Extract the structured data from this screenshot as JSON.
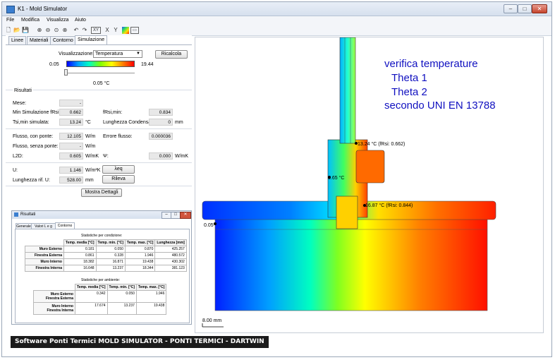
{
  "window": {
    "title": "K1 - Mold Simulator"
  },
  "menu": [
    "File",
    "Modifica",
    "Visualizza",
    "Aiuto"
  ],
  "toolbar": {
    "xy_label": "XY",
    "x_label": "X",
    "y_label": "Y"
  },
  "tabs": [
    "Linee",
    "Materiali",
    "Contorno",
    "Simulazione"
  ],
  "visualization": {
    "label": "Visualizzazione:",
    "selected": "Temperatura",
    "recalc_button": "Ricalcola"
  },
  "scale": {
    "min": "0.05",
    "max": "19.44",
    "slider_value": "0.05 °C",
    "colors": [
      "#0000ff",
      "#00a0ff",
      "#00ffc0",
      "#80ff00",
      "#ffff00",
      "#ff8000",
      "#ff0000"
    ]
  },
  "results": {
    "section_title": "Risultati",
    "mese_label": "Mese:",
    "mese_value": "-",
    "min_sim_label": "Min Simulazione fRsi:",
    "min_sim_value": "0.662",
    "frsi_min_label": "fRsi,min:",
    "frsi_min_value": "0.834",
    "tsi_label": "Tsi,min simulata:",
    "tsi_value": "13.24",
    "tsi_unit": "°C",
    "lung_cond_label": "Lunghezza Condensa:",
    "lung_cond_value": "0",
    "lung_cond_unit": "mm",
    "flusso_con_label": "Flusso, con ponte:",
    "flusso_con_value": "12.105",
    "flusso_con_unit": "W/m",
    "errore_label": "Errore flusso:",
    "errore_value": "0.000036",
    "flusso_senza_label": "Flusso, senza ponte:",
    "flusso_senza_value": "-",
    "flusso_senza_unit": "W/m",
    "l2d_label": "L2D:",
    "l2d_value": "0.605",
    "l2d_unit": "W/mK",
    "psi_label": "Ψ:",
    "psi_value": "0.000",
    "psi_unit": "W/mK",
    "u_label": "U:",
    "u_value": "1.146",
    "u_unit": "W/m²K",
    "lambda_button": "λeq",
    "lung_rif_label": "Lunghezza rif. U:",
    "lung_rif_value": "528.00",
    "lung_rif_unit": "mm",
    "rileva_button": "Rileva",
    "details_button": "Mostra Dettagli"
  },
  "subwindow": {
    "title": "Risultati",
    "tabs": [
      "Generale",
      "Valori L e g",
      "Contorno"
    ],
    "cond_title": "Statistiche per condizione:",
    "cond_headers": [
      "Temp. media [°C]",
      "Temp. min. [°C]",
      "Temp. max. [°C]",
      "Lunghezza [mm]"
    ],
    "cond_rows": [
      {
        "name": "Muro Esterno",
        "values": [
          "0.181",
          "0.050",
          "0.870",
          "425.257"
        ]
      },
      {
        "name": "Finestra Esterna",
        "values": [
          "0.861",
          "0.328",
          "1.946",
          "480.572"
        ]
      },
      {
        "name": "Muro Interno",
        "values": [
          "18.382",
          "16.871",
          "19.438",
          "430.302"
        ]
      },
      {
        "name": "Finestra Interna",
        "values": [
          "16.648",
          "13.237",
          "18.344",
          "381.123"
        ]
      }
    ],
    "amb_title": "Statistiche per ambiente:",
    "amb_headers": [
      "Temp. media [°C]",
      "Temp. min. [°C]",
      "Temp. max. [°C]"
    ],
    "amb_rows": [
      {
        "name1": "Muro Esterno",
        "name2": "Finestra Esterna",
        "values": [
          "0.342",
          "0.050",
          "1.946"
        ]
      },
      {
        "name1": "Muro Interno",
        "name2": "Finestra Interna",
        "values": [
          "17.674",
          "13.237",
          "19.438"
        ]
      }
    ]
  },
  "canvas": {
    "heading": [
      "verifica temperature",
      "Theta 1",
      "Theta 2",
      "secondo UNI EN 13788"
    ],
    "annot1": "13.24 °C (fRsi: 0.662)",
    "annot2": "0.65 °C",
    "annot3": "16.87 °C (fRsi: 0.844)",
    "annot4": "0.05",
    "scale_label": "8.00 mm"
  },
  "caption": "Software Ponti Termici MOLD SIMULATOR - PONTI TERMICI - DARTWIN"
}
